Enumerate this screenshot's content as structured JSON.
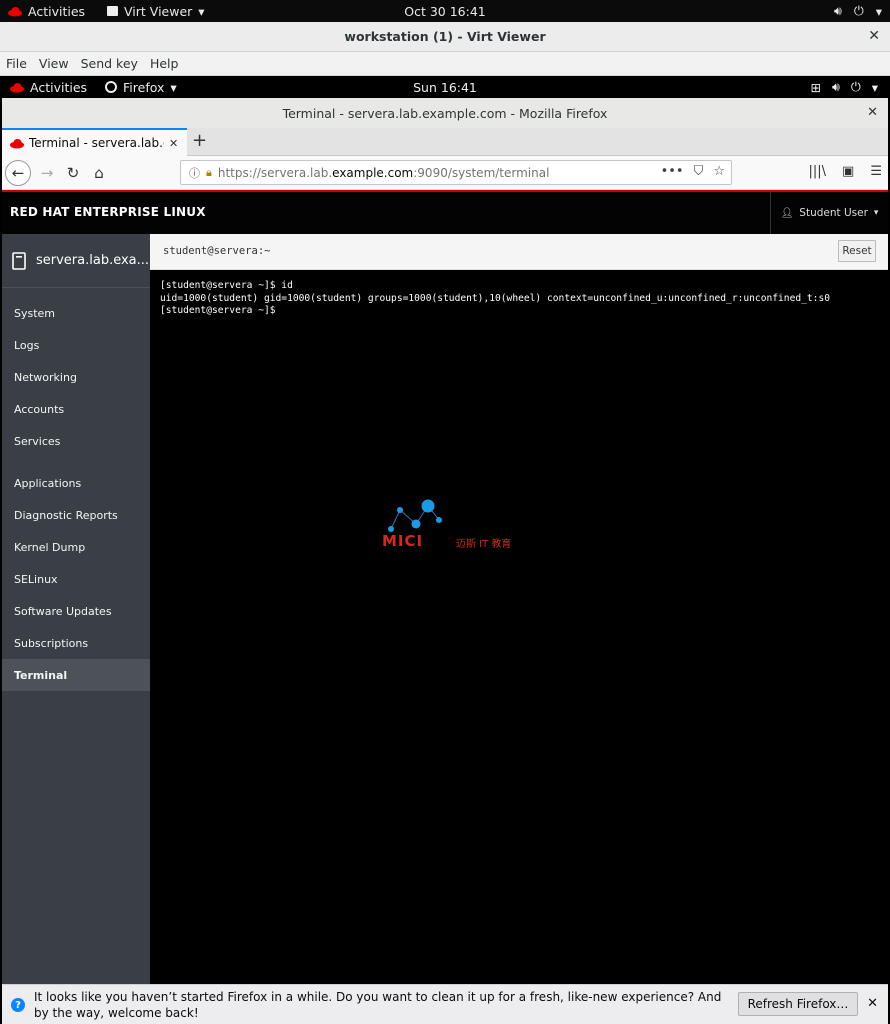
{
  "host_bar": {
    "activities": "Activities",
    "app_name": "Virt Viewer",
    "clock": "Oct 30  16:41"
  },
  "virt_viewer": {
    "title": "workstation (1) - Virt Viewer",
    "menu": [
      "File",
      "View",
      "Send key",
      "Help"
    ]
  },
  "guest_bar": {
    "activities": "Activities",
    "app_name": "Firefox",
    "clock": "Sun 16:41"
  },
  "firefox": {
    "window_title": "Terminal - servera.lab.example.com - Mozilla Firefox",
    "tab_label": "Terminal - servera.lab.example.com",
    "url_prefix": "https://servera.lab.",
    "url_host": "example.com",
    "url_suffix": ":9090/system/terminal"
  },
  "cockpit": {
    "brand": "RED HAT ENTERPRISE LINUX",
    "user": "Student User",
    "host": "servera.lab.exa...",
    "nav_group1": [
      "System",
      "Logs",
      "Networking",
      "Accounts",
      "Services"
    ],
    "nav_group2": [
      "Applications",
      "Diagnostic Reports",
      "Kernel Dump",
      "SELinux",
      "Software Updates",
      "Subscriptions",
      "Terminal"
    ],
    "active_item": "Terminal"
  },
  "terminal": {
    "title": "student@servera:~",
    "reset_label": "Reset",
    "lines": [
      "[student@servera ~]$ id",
      "uid=1000(student) gid=1000(student) groups=1000(student),10(wheel) context=unconfined_u:unconfined_r:unconfined_t:s0",
      "[student@servera ~]$"
    ]
  },
  "watermark": {
    "text": "MICI",
    "subtext": "迈斯 IT 教育"
  },
  "notification": {
    "message": "It looks like you haven’t started Firefox in a while. Do you want to clean it up for a fresh, like-new experience? And by the way, welcome back!",
    "button": "Refresh Firefox…"
  },
  "colors": {
    "accent_blue": "#0a84ff",
    "redhat_red": "#cc0000",
    "sidebar_bg": "#393f44"
  }
}
